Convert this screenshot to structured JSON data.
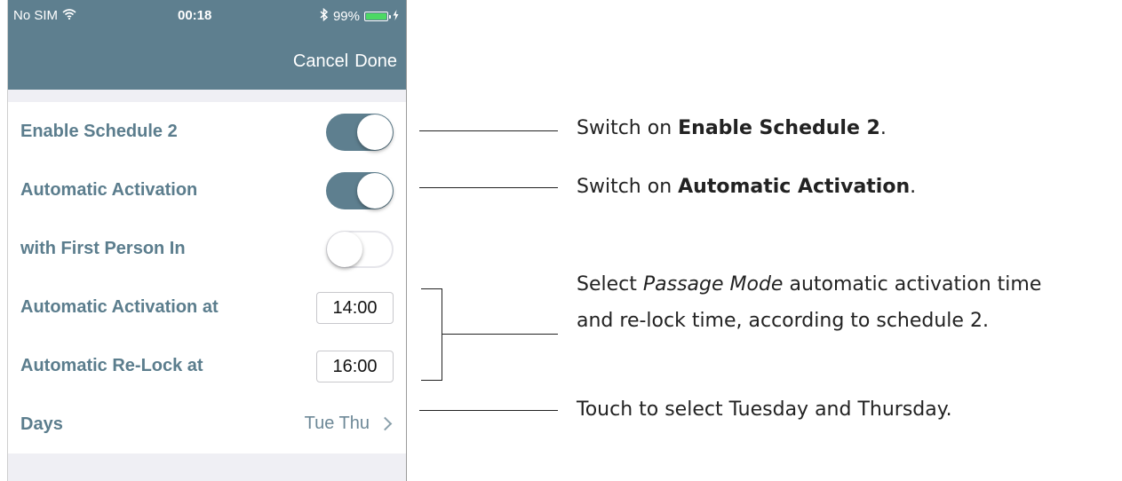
{
  "status_bar": {
    "carrier": "No SIM",
    "time": "00:18",
    "battery": "99%",
    "battery_level": 0.99
  },
  "nav": {
    "cancel_label": "Cancel",
    "done_label": "Done"
  },
  "rows": {
    "enable_schedule": {
      "label": "Enable Schedule 2",
      "on": true
    },
    "automatic_activation": {
      "label": "Automatic Activation",
      "on": true
    },
    "first_person_in": {
      "label": "with First Person In",
      "on": false
    },
    "activation_at": {
      "label": "Automatic Activation at",
      "value": "14:00"
    },
    "relock_at": {
      "label": "Automatic Re-Lock at",
      "value": "16:00"
    },
    "days": {
      "label": "Days",
      "value": "Tue Thu"
    }
  },
  "notes": {
    "enable": {
      "prefix": "Switch on ",
      "bold": "Enable Schedule 2",
      "suffix": "."
    },
    "activation": {
      "prefix": "Switch on ",
      "bold": "Automatic Activation",
      "suffix": "."
    },
    "times": {
      "prefix": "Select ",
      "italic": "Passage Mode",
      "line1_suffix": " automatic activation time",
      "line2": "and re-lock time, according to schedule 2."
    },
    "days": {
      "text": "Touch to select Tuesday and Thursday."
    }
  },
  "colors": {
    "header": "#5e7f8f",
    "label": "#5b7d8d",
    "toggle_on": "#5e7f8f",
    "battery_fill": "#4cd964"
  }
}
